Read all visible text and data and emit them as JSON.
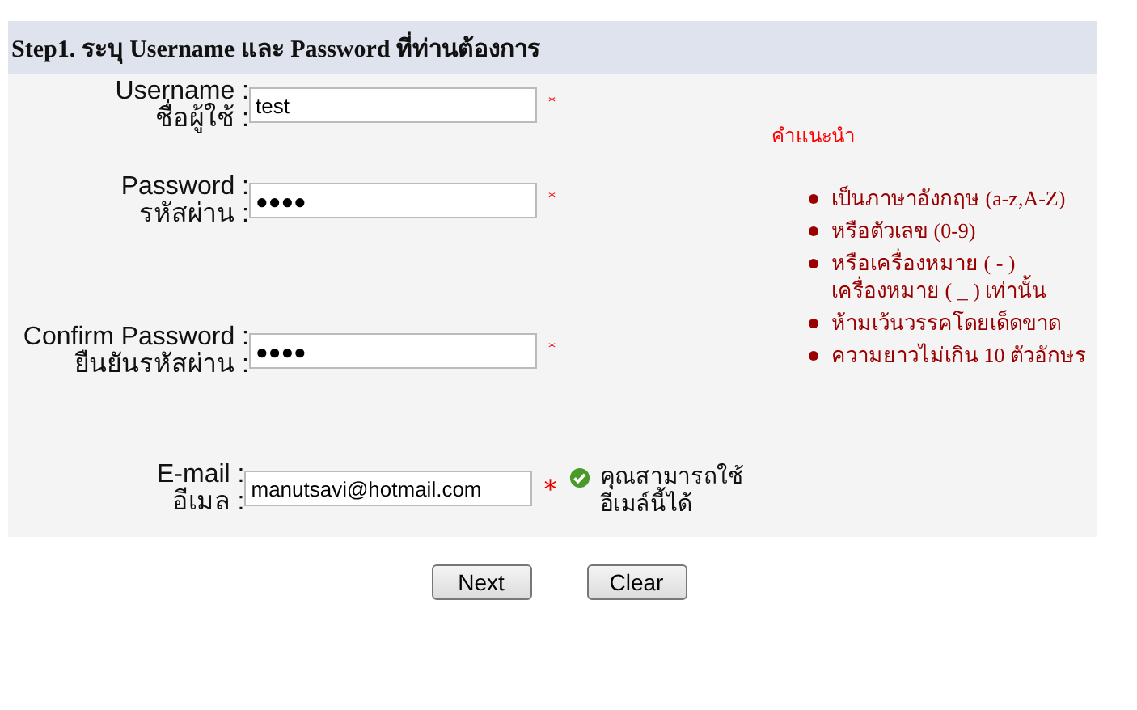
{
  "header": "Step1. ระบุ Username และ Password ที่ท่านต้องการ",
  "fields": [
    {
      "label": "Username :",
      "label_th": "ชื่อผู้ใช้ :",
      "value": "test",
      "required": true,
      "required_mark": "*"
    },
    {
      "label": "Password :",
      "label_th": "รหัสผ่าน :",
      "value": "●●●●",
      "required": true,
      "required_mark": "*"
    },
    {
      "label": "Confirm Password :",
      "label_th": "ยืนยันรหัสผ่าน :",
      "value": "●●●●",
      "required": true,
      "required_mark": "*"
    },
    {
      "label": "E-mail :",
      "label_th": "อีเมล :",
      "value": "manutsavi@hotmail.com",
      "required": true,
      "required_mark": "*",
      "status": {
        "ok": true,
        "message": "คุณสามารถใช้อีเมล์นี้ได้"
      }
    }
  ],
  "hint": {
    "title": "คำแนะนำ",
    "items": [
      "เป็นภาษาอังกฤษ (a-z,A-Z)",
      "หรือตัวเลข (0-9)",
      "หรือเครื่องหมาย ( - ) เครื่องหมาย ( _ ) เท่านั้น",
      "ห้ามเว้นวรรคโดยเด็ดขาด",
      "ความยาวไม่เกิน 10 ตัวอักษร"
    ]
  },
  "buttons": [
    "Next",
    "Clear"
  ]
}
